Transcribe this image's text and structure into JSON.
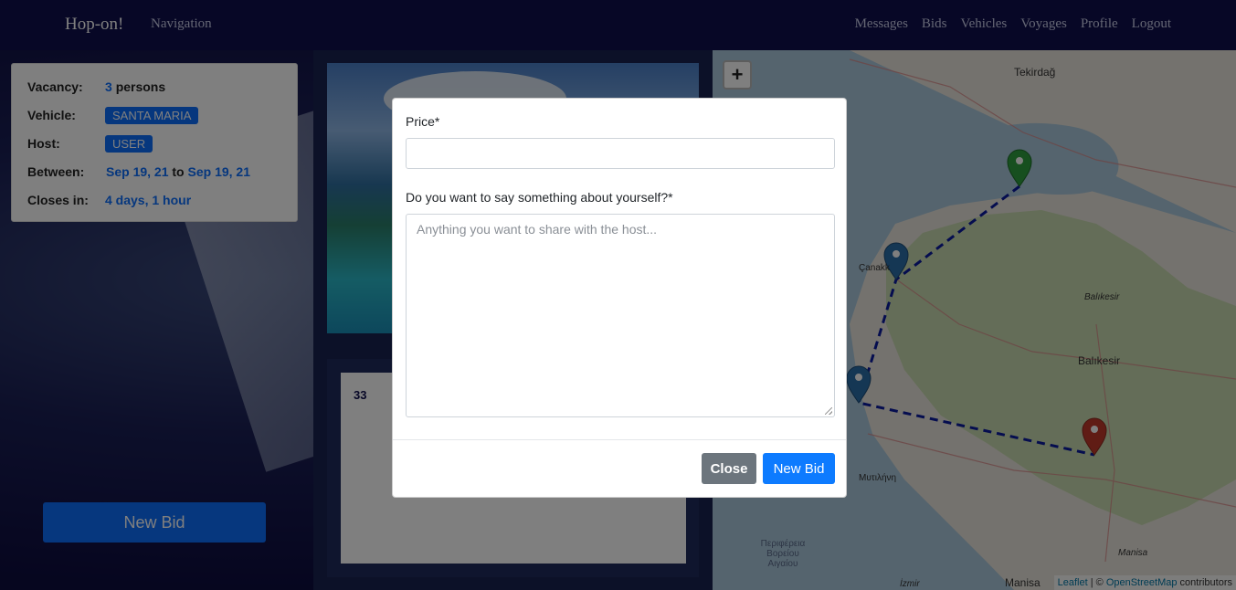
{
  "navbar": {
    "brand": "Hop-on!",
    "navigation_label": "Navigation",
    "links": [
      "Messages",
      "Bids",
      "Vehicles",
      "Voyages",
      "Profile",
      "Logout"
    ]
  },
  "info": {
    "vacancy_label": "Vacancy:",
    "vacancy_count": "3",
    "vacancy_unit": "persons",
    "vehicle_label": "Vehicle:",
    "vehicle_value": "SANTA MARIA",
    "host_label": "Host:",
    "host_value": "USER",
    "between_label": "Between:",
    "between_from": "Sep 19, 21",
    "between_to_word": "to",
    "between_to": "Sep 19, 21",
    "closes_label": "Closes in:",
    "closes_value": "4 days, 1 hour"
  },
  "sidebar": {
    "new_bid_label": "New Bid"
  },
  "lower_card": {
    "number": "33"
  },
  "map": {
    "zoom_in": "+",
    "labels": [
      "Tekirdağ",
      "Çanakk",
      "Balıkesir",
      "Balıkesir",
      "Μυτιλήνη",
      "Περιφέρεια Βορείου Αιγαίου",
      "Manisa",
      "Manisa",
      "İzmir"
    ],
    "attribution": {
      "leaflet": "Leaflet",
      "separator": " | © ",
      "osm": "OpenStreetMap",
      "contributors": " contributors"
    },
    "marker_colors": {
      "start": "#2e9e3e",
      "waypoint": "#2a6ea8",
      "end": "#c0392b"
    },
    "route_color": "#0a1a9e"
  },
  "modal": {
    "price_label": "Price*",
    "price_value": "",
    "about_label": "Do you want to say something about yourself?*",
    "about_placeholder": "Anything you want to share with the host...",
    "close_label": "Close",
    "new_bid_label": "New Bid"
  },
  "colors": {
    "navbar": "#0f0e4d",
    "primary": "#0d6efd",
    "secondary": "#6c757d"
  }
}
